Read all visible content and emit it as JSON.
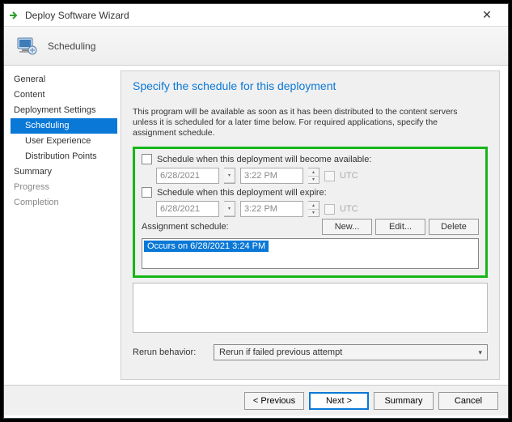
{
  "window": {
    "title": "Deploy Software Wizard"
  },
  "header": {
    "label": "Scheduling"
  },
  "nav": {
    "items": [
      {
        "label": "General"
      },
      {
        "label": "Content"
      },
      {
        "label": "Deployment Settings"
      },
      {
        "label": "Scheduling"
      },
      {
        "label": "User Experience"
      },
      {
        "label": "Distribution Points"
      },
      {
        "label": "Summary"
      },
      {
        "label": "Progress"
      },
      {
        "label": "Completion"
      }
    ]
  },
  "page": {
    "title": "Specify the schedule for this deployment",
    "intro": "This program will be available as soon as it has been distributed to the content servers unless it is scheduled for a later time below. For required applications, specify the assignment schedule.",
    "available": {
      "checkbox_label": "Schedule when this deployment will become available:",
      "date": "6/28/2021",
      "time": "3:22 PM",
      "utc": "UTC"
    },
    "expire": {
      "checkbox_label": "Schedule when this deployment will expire:",
      "date": "6/28/2021",
      "time": "3:22 PM",
      "utc": "UTC"
    },
    "assignment_label": "Assignment schedule:",
    "buttons": {
      "new": "New...",
      "edit": "Edit...",
      "delete": "Delete"
    },
    "schedule_items": [
      "Occurs on 6/28/2021 3:24 PM"
    ],
    "rerun": {
      "label": "Rerun behavior:",
      "value": "Rerun if failed previous attempt"
    }
  },
  "footer": {
    "previous": "< Previous",
    "next": "Next >",
    "summary": "Summary",
    "cancel": "Cancel"
  }
}
